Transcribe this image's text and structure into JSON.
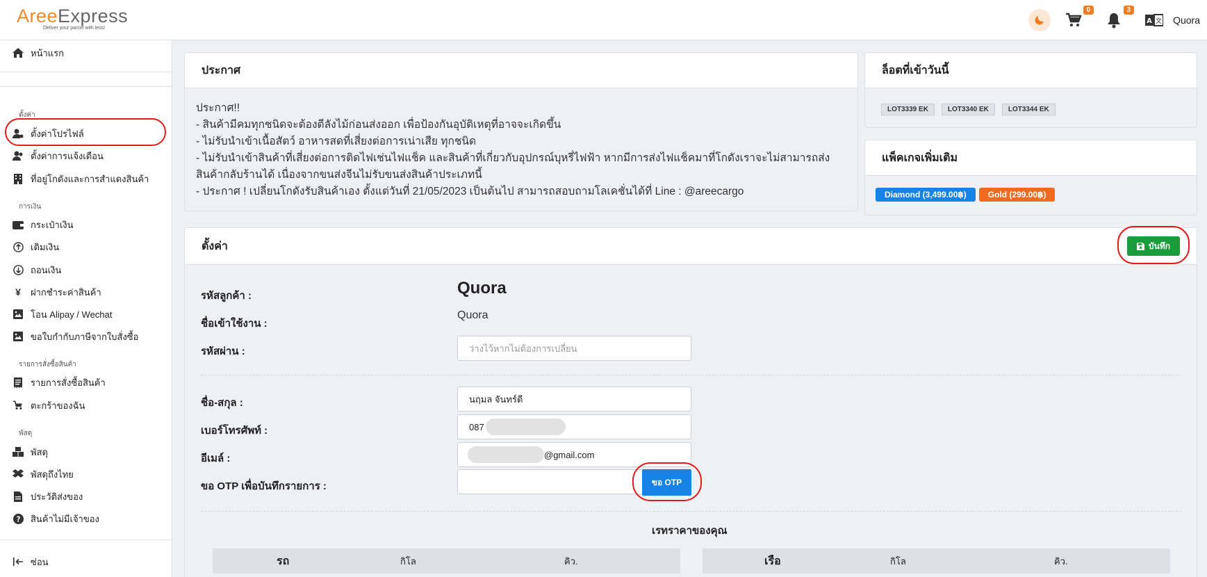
{
  "header": {
    "logo_left": "Aree",
    "logo_right": "Express",
    "logo_tagline": "Deliver your parcel with less!",
    "cart_count": "0",
    "notif_count": "3",
    "username": "Quora"
  },
  "sidebar": {
    "home": "หน้าแรก",
    "section_settings": "ตั้งค่า",
    "profile_settings": "ตั้งค่าโปรไฟล์",
    "notif_settings": "ตั้งค่าการแจ้งเตือน",
    "warehouse_address": "ที่อยู่โกดังและการสำแดงสินค้า",
    "section_finance": "การเงิน",
    "wallet": "กระเป๋าเงิน",
    "topup": "เติมเงิน",
    "withdraw": "ถอนเงิน",
    "pay_goods": "ฝากชำระค่าสินค้า",
    "alipay": "โอน Alipay / Wechat",
    "tax_invoice": "ขอใบกำกับภาษีจากใบสั่งซื้อ",
    "section_orders": "รายการสั่งซื้อสินค้า",
    "order_list": "รายการสั่งซื้อสินค้า",
    "my_cart": "ตะกร้าของฉัน",
    "section_parcels": "พัสดุ",
    "parcels": "พัสดุ",
    "parcels_thai": "พัสดุถึงไทย",
    "shipping_history": "ประวัติส่งของ",
    "unclaimed": "สินค้าไม่มีเจ้าของ",
    "hide": "ซ่อน"
  },
  "announcement": {
    "title": "ประกาศ",
    "lines": [
      "ประกาศ!!",
      "- สินค้ามีคมทุกชนิดจะต้องตีลังไม้ก่อนส่งออก เพื่อป้องกันอุบัติเหตุที่อาจจะเกิดขึ้น",
      "- ไม่รับนำเข้าเนื้อสัตว์ อาหารสดที่เสี่ยงต่อการเน่าเสีย ทุกชนิด",
      "- ไม่รับนำเข้าสินค้าที่เสี่ยงต่อการติดไฟเช่นไฟแช็ค และสินค้าที่เกี่ยวกับอุปกรณ์บุหรี่ไฟฟ้า หากมีการส่งไฟแช็คมาที่โกดังเราจะไม่สามารถส่งสินค้ากลับร้านได้ เนื่องจากขนส่งจีนไม่รับขนส่งสินค้าประเภทนี้",
      "- ประกาศ ! เปลี่ยนโกดังรับสินค้าเอง ตั้งแต่วันที่ 21/05/2023 เป็นต้นไป สามารถสอบถามโลเคชั่นได้ที่ Line : @areecargo"
    ]
  },
  "lots_today": {
    "title": "ล็อตที่เข้าวันนี้",
    "items": [
      "LOT3339 EK",
      "LOT3340 EK",
      "LOT3344 EK"
    ]
  },
  "packages": {
    "title": "แพ็คเกจเพิ่มเติม",
    "diamond": "Diamond (3,499.00฿)",
    "gold": "Gold (299.00฿)",
    "diamond_color": "#1783e6",
    "gold_color": "#ef6b1f"
  },
  "settings": {
    "title": "ตั้งค่า",
    "save_label": "บันทึก",
    "customer_code_label": "รหัสลูกค้า :",
    "customer_code_value": "Quora",
    "username_label": "ชื่อเข้าใช้งาน :",
    "username_value": "Quora",
    "password_label": "รหัสผ่าน :",
    "password_placeholder": "ว่างไว้หากไม่ต้องการเปลี่ยน",
    "fullname_label": "ชื่อ-สกุล :",
    "fullname_value": "นฤมล จันทร์ดี",
    "phone_label": "เบอร์โทรศัพท์ :",
    "phone_value": "087",
    "email_label": "อีเมล์ :",
    "email_value": "@gmail.com",
    "otp_label": "ขอ OTP เพื่อบันทึกรายการ :",
    "otp_button": "ขอ OTP"
  },
  "rates": {
    "title": "เรทราคาของคุณ",
    "car": {
      "head": "รถ",
      "kg": "กิโล",
      "cbm": "คิว."
    },
    "ship": {
      "head": "เรือ",
      "kg": "กิโล",
      "cbm": "คิว."
    }
  }
}
